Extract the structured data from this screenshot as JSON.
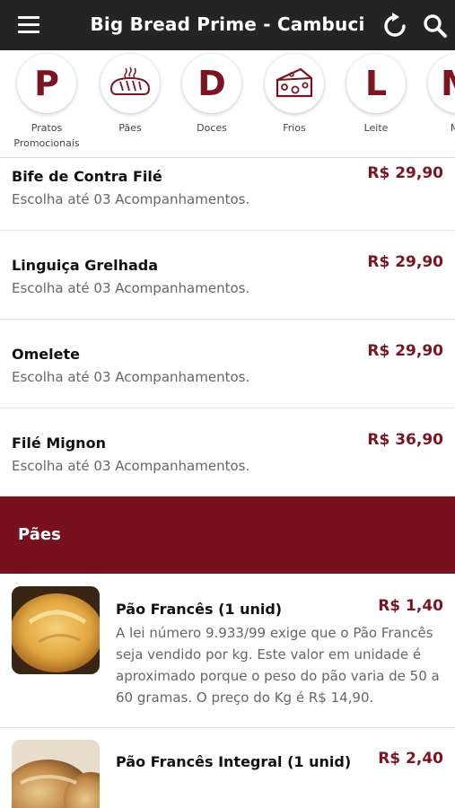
{
  "header": {
    "title": "Big Bread Prime - Cambuci",
    "icons": {
      "menu": "hamburger-icon",
      "refresh": "refresh-icon",
      "search": "search-icon"
    }
  },
  "categories": [
    {
      "glyph": "P",
      "label": "Pratos Promocionais"
    },
    {
      "glyph": "",
      "icon": "bread-icon",
      "label": "Pães"
    },
    {
      "glyph": "D",
      "label": "Doces"
    },
    {
      "glyph": "",
      "icon": "cheese-icon",
      "label": "Frios"
    },
    {
      "glyph": "L",
      "label": "Leite"
    },
    {
      "glyph": "M",
      "label": "Ma"
    }
  ],
  "items": [
    {
      "name": "Bife de Contra Filé",
      "description": "Escolha até 03 Acompanhamentos.",
      "price": "R$ 29,90"
    },
    {
      "name": "Linguiça Grelhada",
      "description": "Escolha até 03 Acompanhamentos.",
      "price": "R$ 29,90"
    },
    {
      "name": "Omelete",
      "description": "Escolha até 03 Acompanhamentos.",
      "price": "R$ 29,90"
    },
    {
      "name": "Filé Mignon",
      "description": "Escolha até 03 Acompanhamentos.",
      "price": "R$ 36,90"
    }
  ],
  "section": {
    "title": "Pães"
  },
  "products": [
    {
      "name": "Pão Francês (1 unid)",
      "price": "R$ 1,40",
      "description": "A lei número 9.933/99 exige que o Pão Francês seja vendido por kg. Este valor em unidade é aproximado porque o peso do pão varia de 50 a 60 gramas. O preço do Kg é R$ 14,90."
    },
    {
      "name": "Pão Francês Integral (1 unid)",
      "price": "R$ 2,40",
      "description": ""
    }
  ],
  "colors": {
    "accent": "#7b1522",
    "section_bg": "#78111e",
    "topbar": "#242424"
  }
}
